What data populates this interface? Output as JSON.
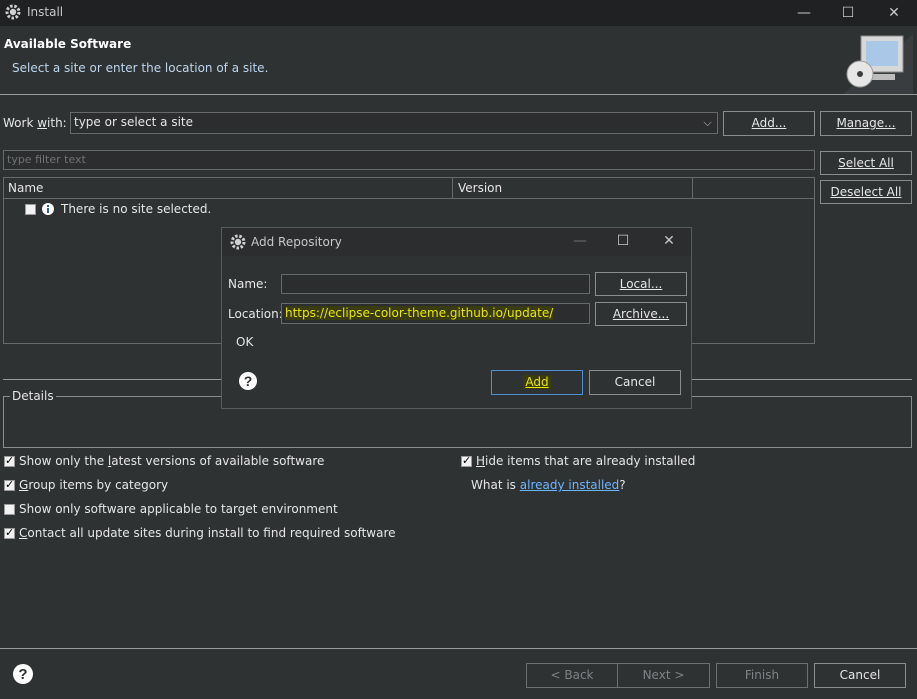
{
  "window": {
    "title": "Install",
    "icon": "eclipse-gear-icon",
    "controls": {
      "minimize": "—",
      "maximize": "☐",
      "close": "✕"
    }
  },
  "header": {
    "title": "Available Software",
    "subtitle": "Select a site or enter the location of a site.",
    "illustration": "monitor-cd-icon"
  },
  "work_with": {
    "label_prefix": "Work ",
    "label_key": "w",
    "label_suffix": "ith:",
    "value": "type or select a site",
    "add_label": "Add...",
    "manage_label": "Manage..."
  },
  "filter": {
    "placeholder": "type filter text"
  },
  "table": {
    "columns": [
      "Name",
      "Version"
    ],
    "rows": [
      {
        "checked": false,
        "icon": "info-icon",
        "name": "There is no site selected."
      }
    ]
  },
  "side_buttons": {
    "select_all": "Select All",
    "deselect_all": "Deselect All"
  },
  "details": {
    "label": "Details"
  },
  "options": {
    "latest_versions": {
      "checked": true,
      "pre": "Show only the ",
      "key": "l",
      "post": "atest versions of available software"
    },
    "group_by_category": {
      "checked": true,
      "pre": "",
      "key": "G",
      "post": "roup items by category"
    },
    "target_env": {
      "checked": false,
      "text": "Show only software applicable to target environment"
    },
    "contact_sites": {
      "checked": true,
      "pre": "",
      "key": "C",
      "post": "ontact all update sites during install to find required software"
    },
    "hide_installed": {
      "checked": true,
      "pre": "",
      "key": "H",
      "post": "ide items that are already installed"
    },
    "what_is": {
      "pre": "What is ",
      "link": "already installed",
      "post": "?"
    }
  },
  "footer": {
    "back": "< Back",
    "next": "Next >",
    "finish": "Finish",
    "cancel": "Cancel"
  },
  "dialog": {
    "title": "Add Repository",
    "name_label": "Name:",
    "name_value": "",
    "location_label": "Location:",
    "location_value": "https://eclipse-color-theme.github.io/update/",
    "local_label": "Local...",
    "archive_label": "Archive...",
    "status": "OK",
    "add_label": "Add",
    "cancel_label": "Cancel"
  },
  "colors": {
    "highlight": "#e0e000",
    "accent": "#5aa0e6",
    "link": "#6cb5ff"
  }
}
